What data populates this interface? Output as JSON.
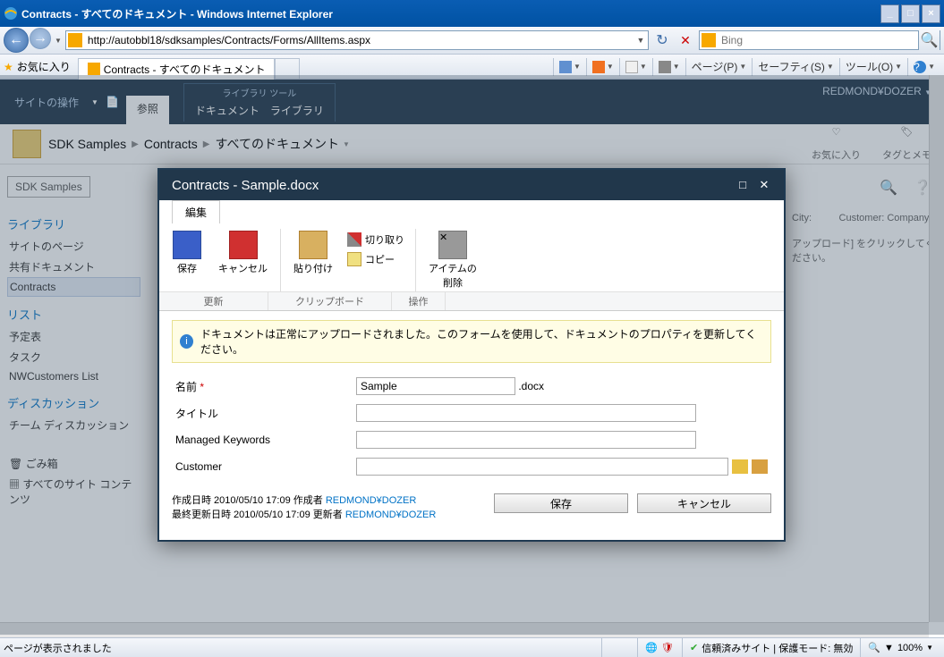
{
  "window": {
    "title": "Contracts - すべてのドキュメント - Windows Internet Explorer",
    "min": "_",
    "max": "□",
    "close": "×"
  },
  "nav": {
    "url": "http://autobbl18/sdksamples/Contracts/Forms/AllItems.aspx",
    "search_placeholder": "Bing"
  },
  "favbar": {
    "fav_label": "お気に入り",
    "tab_title": "Contracts - すべてのドキュメント",
    "page": "ページ(P)",
    "safety": "セーフティ(S)",
    "tool": "ツール(O)"
  },
  "ribbon": {
    "site_actions": "サイトの操作",
    "browse": "参照",
    "lib_tools": "ライブラリ ツール",
    "doc": "ドキュメント",
    "lib": "ライブラリ",
    "user": "REDMOND¥DOZER"
  },
  "breadcrumb": {
    "root": "SDK Samples",
    "lib": "Contracts",
    "view": "すべてのドキュメント",
    "fav_action": "お気に入り",
    "tag_action": "タグとメモ"
  },
  "ql": {
    "box": "SDK Samples",
    "h1": "ライブラリ",
    "i1a": "サイトのページ",
    "i1b": "共有ドキュメント",
    "i1c": "Contracts",
    "h2": "リスト",
    "i2a": "予定表",
    "i2b": "タスク",
    "i2c": "NWCustomers List",
    "h3": "ディスカッション",
    "i3a": "チーム ディスカッション",
    "trash": "ごみ箱",
    "all": "すべてのサイト コンテンツ"
  },
  "rt": {
    "l1": "City:          Customer: CompanyN",
    "l2": "アップロード] をクリックしてください。"
  },
  "dialog": {
    "title": "Contracts - Sample.docx",
    "tab_edit": "編集",
    "btn_save": "保存",
    "btn_cancel": "キャンセル",
    "btn_paste": "貼り付け",
    "btn_cut": "切り取り",
    "btn_copy": "コピー",
    "btn_delete_l1": "アイテムの",
    "btn_delete_l2": "削除",
    "grp_update": "更新",
    "grp_clip": "クリップボード",
    "grp_op": "操作",
    "info": "ドキュメントは正常にアップロードされました。このフォームを使用して、ドキュメントのプロパティを更新してください。",
    "fld_name": "名前",
    "fld_name_val": "Sample",
    "fld_name_ext": ".docx",
    "fld_title": "タイトル",
    "fld_title_val": "",
    "fld_mk": "Managed Keywords",
    "fld_mk_val": "",
    "fld_cust": "Customer",
    "fld_cust_val": "",
    "meta_l1a": "作成日時 2010/05/10 17:09 作成者 ",
    "meta_l1b": "REDMOND¥DOZER",
    "meta_l2a": "最終更新日時 2010/05/10 17:09 更新者 ",
    "meta_l2b": "REDMOND¥DOZER",
    "btn_save2": "保存",
    "btn_cancel2": "キャンセル"
  },
  "status": {
    "msg": "ページが表示されました",
    "zone": "信頼済みサイト | 保護モード: 無効",
    "zoom": "100%"
  }
}
